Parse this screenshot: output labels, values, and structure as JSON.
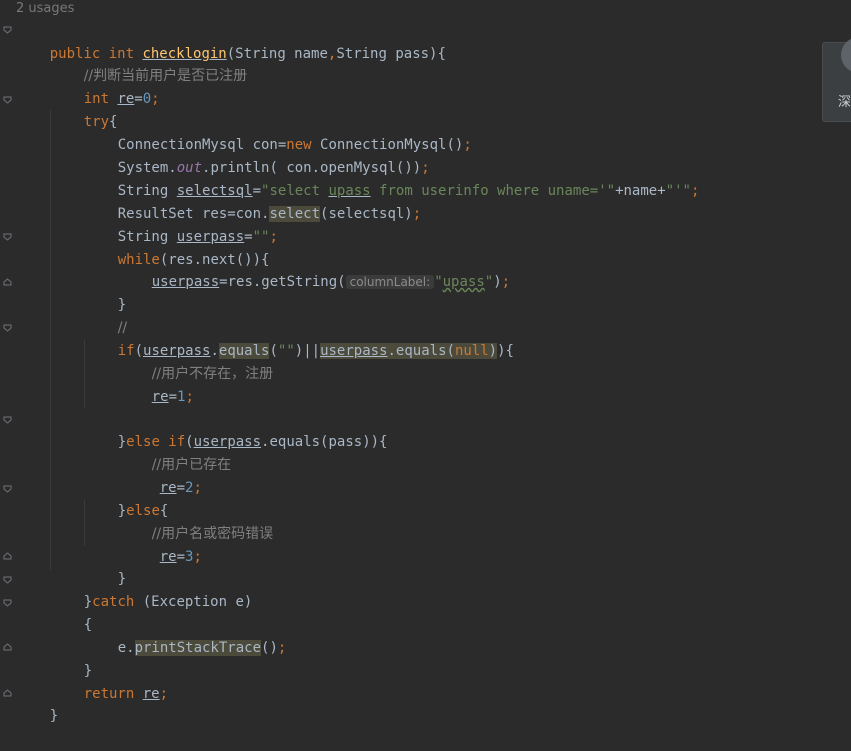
{
  "editor": {
    "usages_hint": "2 usages",
    "lines": {
      "l1": {
        "kw1": "public ",
        "kw2": "int ",
        "fn": "checklogin",
        "rest": "(String name",
        "comma": ",",
        "rest2": "String pass){"
      },
      "l2": {
        "cmt": "//判断当前用户是否已注册"
      },
      "l3": {
        "kw": "int ",
        "var": "re",
        "eq": "=",
        "num": "0",
        "semi": ";"
      },
      "l4": {
        "kw": "try",
        "brace": "{"
      },
      "l5": {
        "a": "ConnectionMysql con=",
        "kw": "new ",
        "b": "ConnectionMysql()",
        "semi": ";"
      },
      "l6": {
        "a": "System.",
        "static": "out",
        "b": ".println( con.openMysql())",
        "semi": ";"
      },
      "l7": {
        "a": "String ",
        "var": "selectsql",
        "eq": "=",
        "s1": "\"select ",
        "s2": "upass",
        "s3": " from userinfo where uname='\"",
        "b": "+name+",
        "s4": "\"'\"",
        "semi": ";"
      },
      "l8": {
        "a": "ResultSet res=con.",
        "hl": "select",
        "b": "(selectsql)",
        "semi": ";"
      },
      "l9": {
        "a": "String ",
        "var": "userpass",
        "eq": "=",
        "str": "\"\"",
        "semi": ";"
      },
      "l10": {
        "kw": "while",
        "a": "(res.next()){"
      },
      "l11": {
        "var": "userpass",
        "a": "=res.getString(",
        "hint": "columnLabel:",
        "s1": "\"",
        "s2": "upass",
        "s3": "\"",
        "b": ")",
        "semi": ";"
      },
      "l12": {
        "a": "}"
      },
      "l13": {
        "cmt": "//"
      },
      "l14": {
        "kw": "if",
        "a": "(",
        "var1": "userpass",
        "dot": ".",
        "hl1": "equals",
        "b": "(",
        "str": "\"\"",
        "c": ")||",
        "var2": "userpass",
        "hl2a": ".equals(",
        "kwnull": "null",
        "hl2b": ")",
        "d": "){"
      },
      "l15": {
        "cmt": "//用户不存在，注册"
      },
      "l16": {
        "var": "re",
        "eq": "=",
        "num": "1",
        "semi": ";"
      },
      "l18": {
        "a": "}",
        "kw": "else if",
        "b": "(",
        "var": "userpass",
        "c": ".equals(pass)){"
      },
      "l19": {
        "cmt": "//用户已存在"
      },
      "l20": {
        "var": "re",
        "eq": "=",
        "num": "2",
        "semi": ";"
      },
      "l21": {
        "a": "}",
        "kw": "else",
        "b": "{"
      },
      "l22": {
        "cmt": "//用户名或密码错误"
      },
      "l23": {
        "var": "re",
        "eq": "=",
        "num": "3",
        "semi": ";"
      },
      "l24": {
        "a": "}"
      },
      "l25": {
        "a": "}",
        "kw": "catch ",
        "b": "(Exception e)"
      },
      "l26": {
        "a": "{"
      },
      "l27": {
        "a": "e.",
        "hl": "printStackTrace",
        "b": "()",
        "semi": ";"
      },
      "l28": {
        "a": "}"
      },
      "l29": {
        "kw": "return ",
        "var": "re",
        "semi": ";"
      },
      "l30": {
        "a": "}"
      }
    }
  },
  "side_widget": {
    "label": "深"
  }
}
